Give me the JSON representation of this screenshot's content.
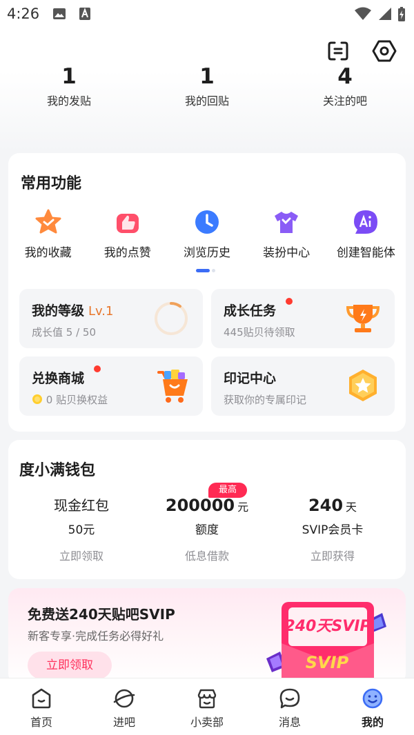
{
  "status_bar": {
    "time": "4:26"
  },
  "stats": [
    {
      "count": "1",
      "label": "我的发贴"
    },
    {
      "count": "1",
      "label": "我的回贴"
    },
    {
      "count": "4",
      "label": "关注的吧"
    }
  ],
  "common_functions": {
    "title": "常用功能",
    "items": [
      {
        "label": "我的收藏",
        "icon": "star-icon"
      },
      {
        "label": "我的点赞",
        "icon": "thumbs-up-icon"
      },
      {
        "label": "浏览历史",
        "icon": "clock-icon"
      },
      {
        "label": "装扮中心",
        "icon": "tshirt-icon"
      },
      {
        "label": "创建智能体",
        "icon": "ai-chat-icon"
      }
    ],
    "tiles": {
      "level": {
        "title": "我的等级",
        "level": "Lv.1",
        "sub": "成长值 5 / 50",
        "progress": 0.1
      },
      "growth": {
        "title": "成长任务",
        "sub": "445贴贝待领取"
      },
      "exchange": {
        "title": "兑换商城",
        "coin_text": "0 贴贝换权益"
      },
      "mark": {
        "title": "印记中心",
        "sub": "获取你的专属印记"
      }
    }
  },
  "wallet": {
    "title": "度小满钱包",
    "badge": "最高",
    "items": [
      {
        "top": "现金红包",
        "mid": "50元",
        "action": "立即领取"
      },
      {
        "amount": "200000",
        "unit": "元",
        "mid": "额度",
        "action": "低息借款"
      },
      {
        "amount": "240",
        "unit": "天",
        "mid": "SVIP会员卡",
        "action": "立即获得"
      }
    ]
  },
  "promo": {
    "title": "免费送240天贴吧SVIP",
    "subtitle": "新客专享·完成任务必得好礼",
    "button": "立即领取",
    "card_text": "240天SVIP",
    "card_logo": "SVIP"
  },
  "tabbar": [
    {
      "label": "首页",
      "icon": "home-icon"
    },
    {
      "label": "进吧",
      "icon": "planet-icon"
    },
    {
      "label": "小卖部",
      "icon": "shop-icon"
    },
    {
      "label": "消息",
      "icon": "message-icon"
    },
    {
      "label": "我的",
      "icon": "smiley-icon",
      "active": true
    }
  ],
  "colors": {
    "accent_blue": "#3b6cf5",
    "red_badge": "#ff2a53",
    "level_orange": "#e7762b"
  }
}
